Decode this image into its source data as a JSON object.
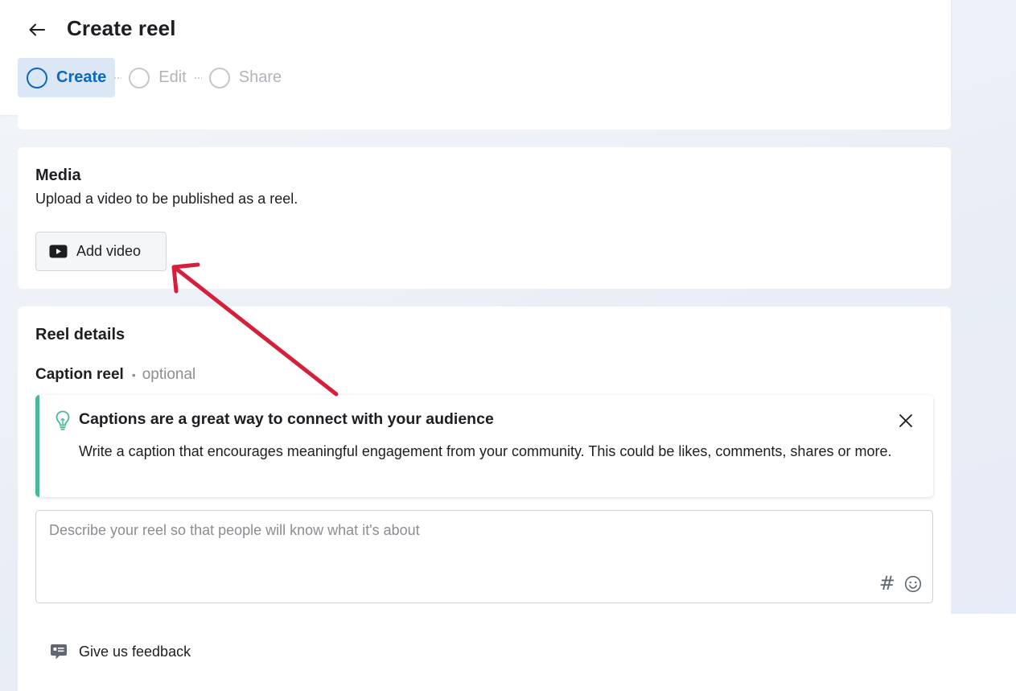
{
  "header": {
    "title": "Create reel",
    "back_icon": "arrow-left-icon"
  },
  "stepper": {
    "steps": [
      {
        "label": "Create",
        "active": true
      },
      {
        "label": "Edit",
        "active": false
      },
      {
        "label": "Share",
        "active": false
      }
    ]
  },
  "media": {
    "heading": "Media",
    "description": "Upload a video to be published as a reel.",
    "add_video_label": "Add video",
    "add_video_icon": "video-play-icon"
  },
  "details": {
    "heading": "Reel details",
    "caption_label": "Caption reel",
    "caption_separator": "•",
    "caption_optional": "optional",
    "tip": {
      "icon": "lightbulb-icon",
      "title": "Captions are a great way to connect with your audience",
      "body": "Write a caption that encourages meaningful engagement from your community. This could be likes, comments, shares or more."
    },
    "caption_placeholder": "Describe your reel so that people will know what it's about",
    "caption_value": "",
    "hashtag_symbol": "#"
  },
  "footer": {
    "feedback_label": "Give us feedback",
    "feedback_icon": "feedback-chat-icon"
  },
  "colors": {
    "accent": "#0a67c2",
    "active_step_bg": "#dbe7f5",
    "tip_border": "#4bb79a",
    "annotation_arrow": "#d61f3a"
  }
}
